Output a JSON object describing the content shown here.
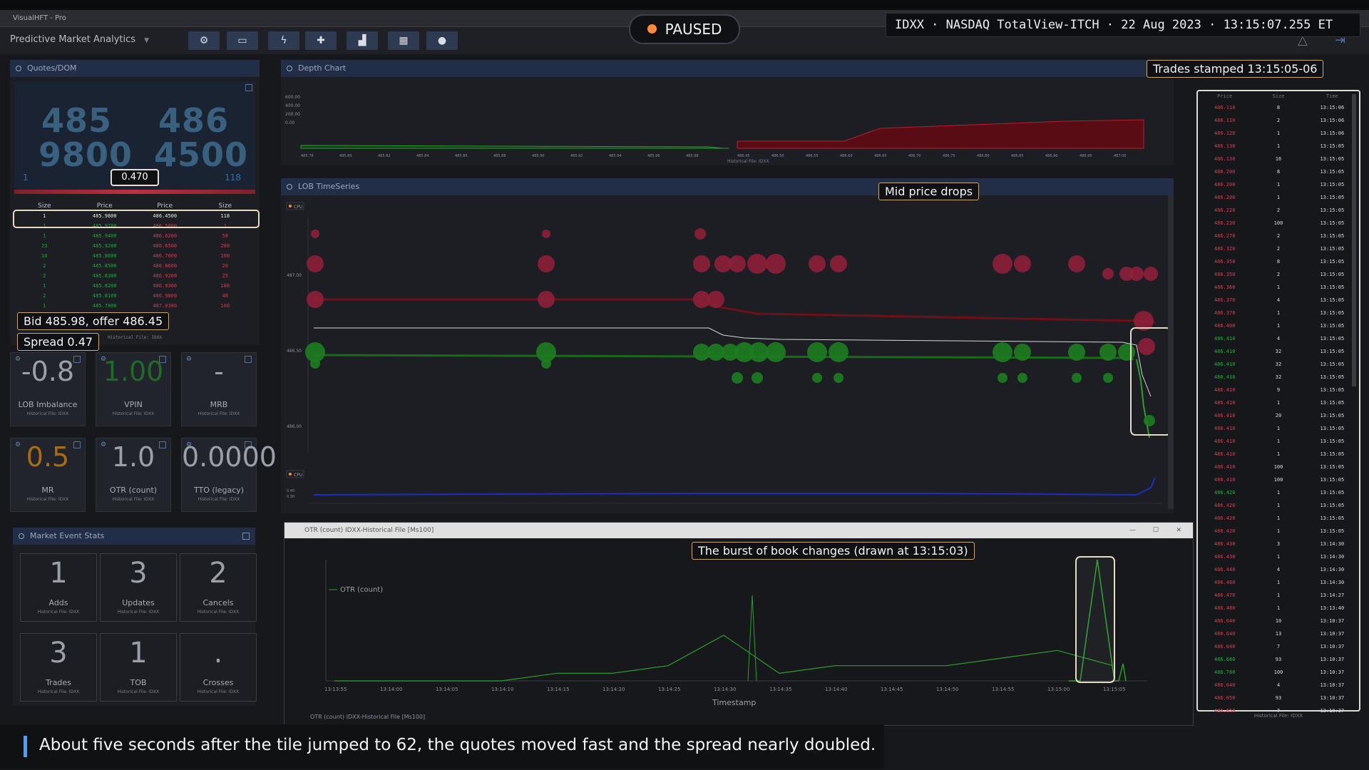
{
  "app_title": "VisualHFT - Pro",
  "toolbar": {
    "workspace": "Predictive Market Analytics",
    "buttons": [
      "settings-icon",
      "monitor-icon",
      "bolt-icon",
      "puzzle-icon",
      "chart-icon",
      "grid-icon",
      "user-icon"
    ]
  },
  "status": {
    "paused_label": "PAUSED"
  },
  "ticker": "IDXX · NASDAQ TotalView-ITCH · 22 Aug 2023 · 13:15:07.255 ET",
  "quotes": {
    "title": "Quotes/DOM",
    "bid_big_top": "485",
    "bid_big_bottom": "9800",
    "ask_big_top": "486",
    "ask_big_bottom": "4500",
    "spread_box": "0.470",
    "bid_size_small": "1",
    "ask_size_small": "118",
    "columns": [
      "Size",
      "Price",
      "Price",
      "Size"
    ],
    "rows": [
      [
        "1",
        "485.9800",
        "486.4500",
        "118"
      ],
      [
        "1",
        "485.9700",
        "486.5800",
        "1"
      ],
      [
        "1",
        "485.9400",
        "486.6200",
        "58"
      ],
      [
        "23",
        "485.9200",
        "486.6500",
        "200"
      ],
      [
        "10",
        "485.8600",
        "486.7000",
        "100"
      ],
      [
        "2",
        "485.8500",
        "486.8600",
        "20"
      ],
      [
        "2",
        "485.8300",
        "486.9200",
        "25"
      ],
      [
        "1",
        "485.8200",
        "486.9300",
        "100"
      ],
      [
        "2",
        "485.8100",
        "486.9800",
        "48"
      ],
      [
        "1",
        "485.7800",
        "487.0300",
        "100"
      ]
    ],
    "footer": "Historical File: IDXX"
  },
  "callouts": {
    "bid_offer": "Bid 485.98, offer 486.45",
    "spread": "Spread 0.47",
    "trades_stamped": "Trades stamped 13:15:05-06",
    "mid_price": "Mid price drops",
    "burst": "The burst of book changes (drawn at 13:15:03)"
  },
  "metric_tiles": [
    {
      "value": "-0.8",
      "label": "LOB Imbalance",
      "source": "Historical File: IDXX",
      "color": "#9aa0aa"
    },
    {
      "value": "1.00",
      "label": "VPIN",
      "source": "Historical File: IDXX",
      "color": "#1f6a26"
    },
    {
      "value": "-",
      "label": "MRB",
      "source": "Historical File: IDXX",
      "color": "#9aa0aa"
    },
    {
      "value": "0.5",
      "label": "MR",
      "source": "Historical File: IDXX",
      "color": "#a86d12"
    },
    {
      "value": "1.0",
      "label": "OTR (count)",
      "source": "Historical File: IDXX",
      "color": "#9aa0aa"
    },
    {
      "value": "0.0000",
      "label": "TTO (legacy)",
      "source": "Historical File: IDXX",
      "color": "#9aa0aa"
    }
  ],
  "market_event_stats": {
    "title": "Market Event Stats",
    "tiles": [
      {
        "value": "1",
        "label": "Adds",
        "source": "Historical File: IDXX"
      },
      {
        "value": "3",
        "label": "Updates",
        "source": "Historical File: IDXX"
      },
      {
        "value": "2",
        "label": "Cancels",
        "source": "Historical File: IDXX"
      },
      {
        "value": "3",
        "label": "Trades",
        "source": "Historical File: IDXX"
      },
      {
        "value": "1",
        "label": "TOB",
        "source": "Historical File: IDXX"
      },
      {
        "value": ".",
        "label": "Crosses",
        "source": "Historical File: IDXX"
      }
    ]
  },
  "depth_chart": {
    "title": "Depth Chart",
    "footer": "Historical File: IDXX",
    "y_ticks": [
      "600.00",
      "400.00",
      "200.00",
      "0.00"
    ],
    "bid_ticks": [
      "485.78",
      "485.80",
      "485.82",
      "485.84",
      "485.86",
      "485.88",
      "485.90",
      "485.92",
      "485.94",
      "485.96",
      "485.98"
    ],
    "ask_ticks": [
      "486.45",
      "486.50",
      "486.55",
      "486.60",
      "486.65",
      "486.70",
      "486.75",
      "486.80",
      "486.85",
      "486.90",
      "486.95",
      "487.00"
    ]
  },
  "lob_timeseries": {
    "title": "LOB TimeSeries",
    "y_ticks": [
      "487.00",
      "486.50",
      "486.00"
    ],
    "legend": "CPU",
    "lower_ticks": [
      "0.40",
      "0.30"
    ]
  },
  "otr_window": {
    "title": "OTR (count) IDXX-Historical File [Ms100]",
    "legend": "OTR (count)",
    "xlabel": "Timestamp",
    "footer": "OTR (count) IDXX-Historical File [Ms100]"
  },
  "chart_data": {
    "type": "line",
    "x": [
      "13:13:55",
      "13:14:00",
      "13:14:05",
      "13:14:10",
      "13:14:15",
      "13:14:20",
      "13:14:25",
      "13:14:30",
      "13:14:35",
      "13:14:40",
      "13:14:45",
      "13:14:50",
      "13:14:55",
      "13:15:00",
      "13:15:05"
    ],
    "series": [
      {
        "name": "OTR (count)",
        "values": [
          0,
          0,
          0,
          0,
          0.5,
          0.5,
          1,
          3,
          0.5,
          1,
          1,
          1,
          1.5,
          2,
          1
        ]
      }
    ],
    "xlabel": "Timestamp"
  },
  "trades_panel": {
    "columns": [
      "Price",
      "Size",
      "Time"
    ],
    "footer": "Historical File: IDXX",
    "rows": [
      [
        "486.110",
        "8",
        "13:15:06",
        "r"
      ],
      [
        "486.110",
        "2",
        "13:15:06",
        "r"
      ],
      [
        "486.120",
        "1",
        "13:15:06",
        "r"
      ],
      [
        "486.130",
        "1",
        "13:15:05",
        "r"
      ],
      [
        "486.130",
        "16",
        "13:15:05",
        "r"
      ],
      [
        "486.200",
        "8",
        "13:15:05",
        "r"
      ],
      [
        "486.200",
        "1",
        "13:15:05",
        "r"
      ],
      [
        "486.200",
        "1",
        "13:15:05",
        "r"
      ],
      [
        "486.220",
        "2",
        "13:15:05",
        "r"
      ],
      [
        "486.230",
        "100",
        "13:15:05",
        "r"
      ],
      [
        "486.270",
        "2",
        "13:15:05",
        "r"
      ],
      [
        "486.320",
        "2",
        "13:15:05",
        "r"
      ],
      [
        "486.350",
        "8",
        "13:15:05",
        "r"
      ],
      [
        "486.350",
        "2",
        "13:15:05",
        "r"
      ],
      [
        "486.360",
        "1",
        "13:15:05",
        "r"
      ],
      [
        "486.370",
        "4",
        "13:15:05",
        "r"
      ],
      [
        "486.370",
        "1",
        "13:15:05",
        "r"
      ],
      [
        "486.400",
        "1",
        "13:15:05",
        "r"
      ],
      [
        "486.410",
        "4",
        "13:15:05",
        "g"
      ],
      [
        "486.410",
        "32",
        "13:15:05",
        "g"
      ],
      [
        "486.410",
        "32",
        "13:15:05",
        "g"
      ],
      [
        "486.410",
        "32",
        "13:15:05",
        "g"
      ],
      [
        "486.410",
        "9",
        "13:15:05",
        "r"
      ],
      [
        "486.410",
        "1",
        "13:15:05",
        "r"
      ],
      [
        "486.410",
        "20",
        "13:15:05",
        "r"
      ],
      [
        "486.410",
        "1",
        "13:15:05",
        "r"
      ],
      [
        "486.410",
        "1",
        "13:15:05",
        "r"
      ],
      [
        "486.410",
        "1",
        "13:15:05",
        "r"
      ],
      [
        "486.410",
        "100",
        "13:15:05",
        "r"
      ],
      [
        "486.410",
        "100",
        "13:15:05",
        "r"
      ],
      [
        "486.420",
        "1",
        "13:15:05",
        "g"
      ],
      [
        "486.420",
        "1",
        "13:15:05",
        "r"
      ],
      [
        "486.420",
        "1",
        "13:15:05",
        "r"
      ],
      [
        "486.420",
        "1",
        "13:15:05",
        "r"
      ],
      [
        "486.430",
        "3",
        "13:14:30",
        "r"
      ],
      [
        "486.430",
        "1",
        "13:14:30",
        "r"
      ],
      [
        "486.440",
        "4",
        "13:14:30",
        "r"
      ],
      [
        "486.460",
        "1",
        "13:14:30",
        "r"
      ],
      [
        "486.470",
        "1",
        "13:14:27",
        "r"
      ],
      [
        "486.480",
        "1",
        "13:13:40",
        "r"
      ],
      [
        "486.640",
        "10",
        "13:10:37",
        "r"
      ],
      [
        "486.640",
        "13",
        "13:10:37",
        "r"
      ],
      [
        "486.640",
        "7",
        "13:10:37",
        "r"
      ],
      [
        "486.680",
        "93",
        "13:10:37",
        "g"
      ],
      [
        "486.780",
        "100",
        "13:10:37",
        "g"
      ],
      [
        "486.640",
        "4",
        "13:10:37",
        "r"
      ],
      [
        "486.650",
        "93",
        "13:10:37",
        "r"
      ],
      [
        "486.650",
        "7",
        "13:10:37",
        "r"
      ]
    ]
  },
  "subtitle": "About five seconds after the tile jumped to 62, the quotes moved fast and the spread nearly doubled.",
  "colors": {
    "bid": "#2aa02a",
    "ask": "#8a1c28",
    "accent": "#4aa0ff",
    "paused_dot": "#ff8a3c"
  }
}
